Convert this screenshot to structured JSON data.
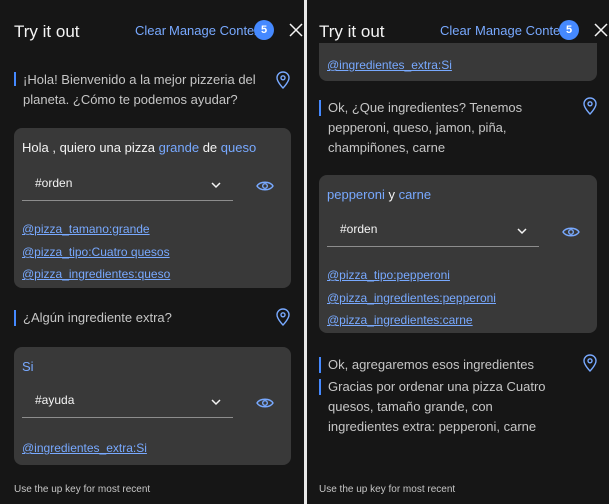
{
  "panels": [
    {
      "title": "Try it out",
      "clear_label": "Clear",
      "manage_context_label": "Manage Context",
      "context_count": "5",
      "bot_messages": [
        "¡Hola! Bienvenido a la mejor pizzeria del planeta. ¿Cómo te podemos ayudar?",
        "¿Algún ingrediente extra?"
      ],
      "cards": [
        {
          "utterance_parts": [
            {
              "text": "Hola , quiero una pizza ",
              "entity": false
            },
            {
              "text": "grande",
              "entity": true
            },
            {
              "text": " de ",
              "entity": false
            },
            {
              "text": "queso",
              "entity": true
            }
          ],
          "intent": "#orden",
          "entities": [
            "@pizza_tamano:grande",
            "@pizza_tipo:Cuatro quesos",
            "@pizza_ingredientes:queso"
          ]
        },
        {
          "utterance_parts": [
            {
              "text": "Si",
              "entity": true
            }
          ],
          "intent": "#ayuda",
          "entities": [
            "@ingredientes_extra:Si"
          ]
        }
      ],
      "input_hint": "Use the up key for most recent"
    },
    {
      "title": "Try it out",
      "clear_label": "Clear",
      "manage_context_label": "Manage Context",
      "context_count": "5",
      "top_entity": "@ingredientes_extra:Si",
      "bot_messages": [
        "Ok, ¿Que ingredientes? Tenemos pepperoni, queso, jamon, piña, champiñones, carne",
        "Ok, agregaremos esos ingredientes",
        "Gracias por ordenar una pizza Cuatro quesos, tamaño grande, con ingredientes extra: pepperoni, carne"
      ],
      "cards": [
        {
          "utterance_parts": [
            {
              "text": "pepperoni",
              "entity": true
            },
            {
              "text": " y ",
              "entity": false
            },
            {
              "text": "carne",
              "entity": true
            }
          ],
          "intent": "#orden",
          "entities": [
            "@pizza_tipo:pepperoni",
            "@pizza_ingredientes:pepperoni",
            "@pizza_ingredientes:carne"
          ]
        }
      ],
      "input_hint": "Use the up key for most recent"
    }
  ],
  "colors": {
    "panel_bg": "#161616",
    "card_bg": "#393939",
    "link": "#78a9ff",
    "accent": "#4589ff",
    "text": "#f4f4f4"
  }
}
